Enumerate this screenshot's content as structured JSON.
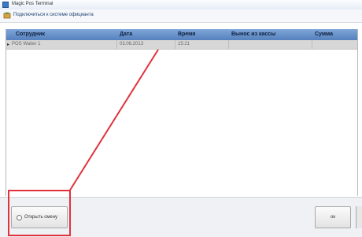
{
  "window": {
    "title": "Magic Pos Terminal"
  },
  "toolbar": {
    "link_label": "Подключиться к системе официанта"
  },
  "table": {
    "columns": [
      "Сотрудник",
      "Дата",
      "Время",
      "Вынос из кассы",
      "Сумма"
    ],
    "rows": [
      {
        "marker": "▸",
        "employee": "POS Waiter 1",
        "date": "03.06.2013",
        "time": "15:21",
        "cash_out": "",
        "sum": ""
      }
    ]
  },
  "buttons": {
    "close_shift": "Открыть смену",
    "ok": "ок"
  },
  "annotation": {
    "color": "#e0323d"
  }
}
